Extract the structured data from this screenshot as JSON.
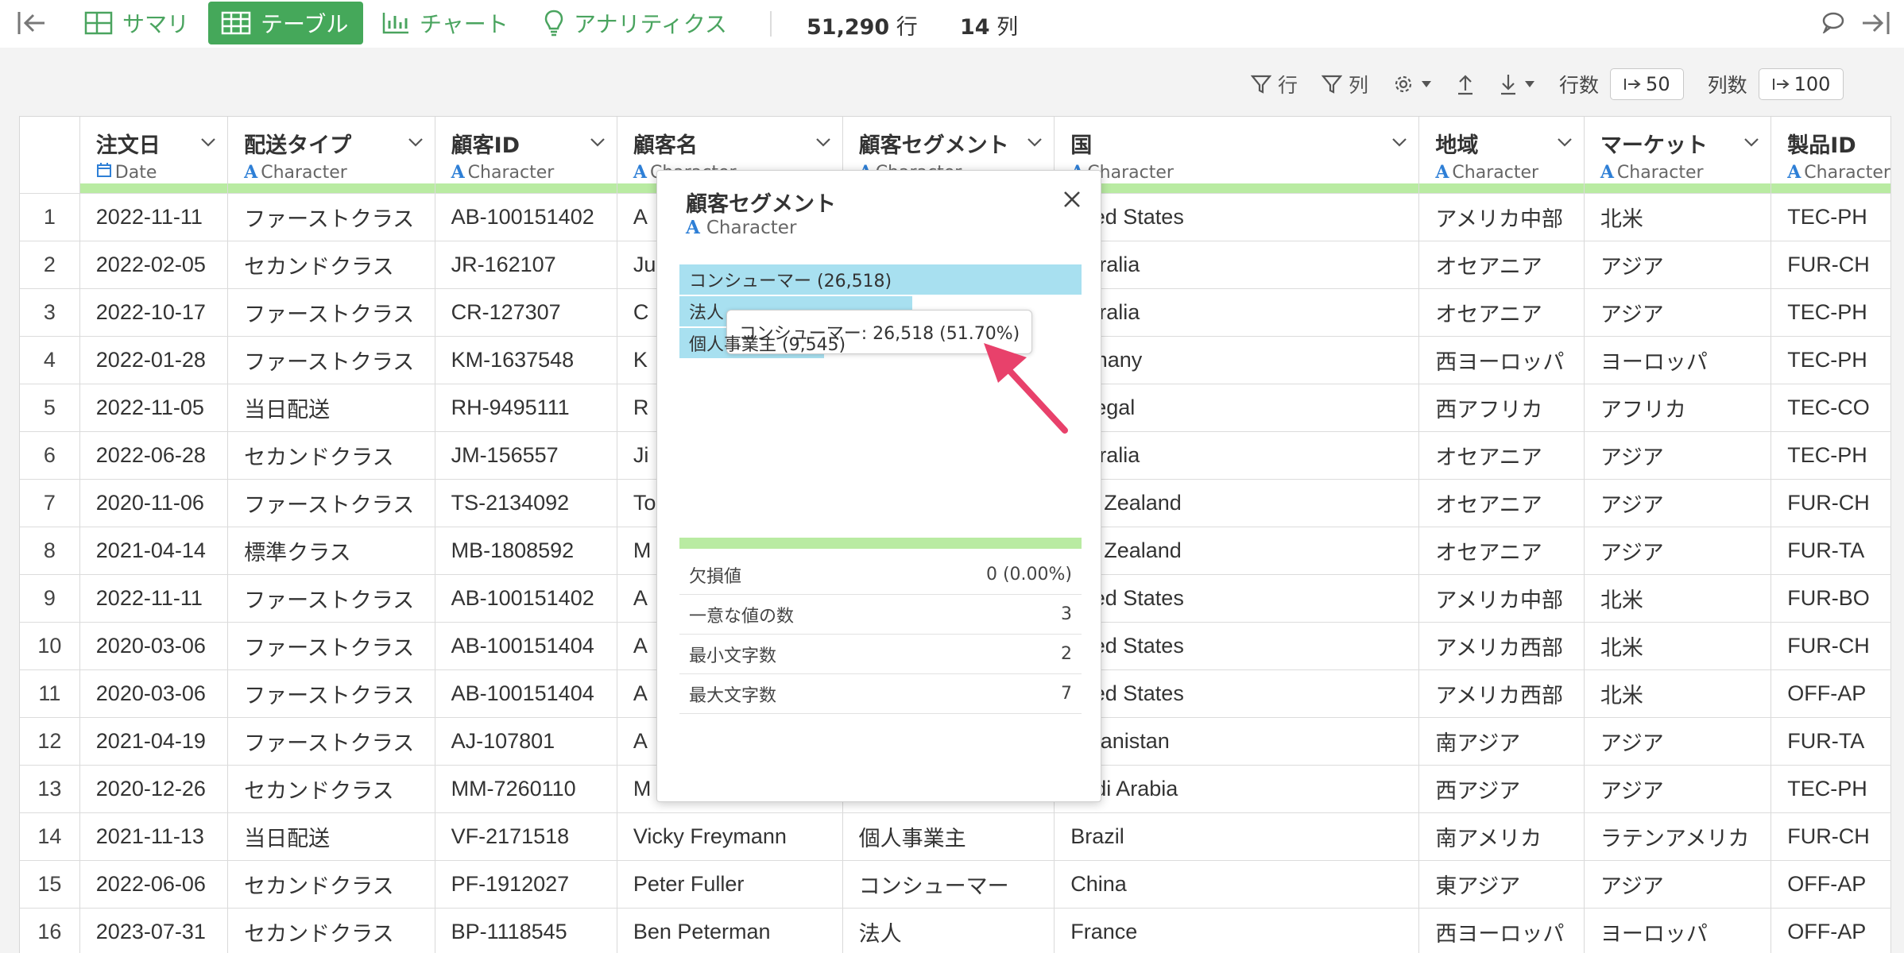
{
  "topbar": {
    "tabs": [
      {
        "label": "サマリ",
        "icon": "table-outline-icon"
      },
      {
        "label": "テーブル",
        "icon": "table-grid-icon",
        "active": true
      },
      {
        "label": "チャート",
        "icon": "bar-chart-icon"
      },
      {
        "label": "アナリティクス",
        "icon": "lightbulb-icon"
      }
    ],
    "rows_count": "51,290",
    "rows_unit": "行",
    "cols_count": "14",
    "cols_unit": "列"
  },
  "toolbar": {
    "row_filter": "行",
    "col_filter": "列",
    "rows_label": "行数",
    "rows_value": "50",
    "cols_label": "列数",
    "cols_value": "100"
  },
  "table": {
    "columns": [
      {
        "title": "注文日",
        "type": "Date"
      },
      {
        "title": "配送タイプ",
        "type": "Character"
      },
      {
        "title": "顧客ID",
        "type": "Character"
      },
      {
        "title": "顧客名",
        "type": "Character"
      },
      {
        "title": "顧客セグメント",
        "type": "Character"
      },
      {
        "title": "国",
        "type": "Character"
      },
      {
        "title": "地域",
        "type": "Character"
      },
      {
        "title": "マーケット",
        "type": "Character"
      },
      {
        "title": "製品ID",
        "type": "Character"
      }
    ],
    "rows": [
      [
        "1",
        "2022-11-11",
        "ファーストクラス",
        "AB-100151402",
        "A",
        "",
        "nited States",
        "アメリカ中部",
        "北米",
        "TEC-PH"
      ],
      [
        "2",
        "2022-02-05",
        "セカンドクラス",
        "JR-162107",
        "Ju",
        "",
        "ustralia",
        "オセアニア",
        "アジア",
        "FUR-CH"
      ],
      [
        "3",
        "2022-10-17",
        "ファーストクラス",
        "CR-127307",
        "C",
        "",
        "ustralia",
        "オセアニア",
        "アジア",
        "TEC-PH"
      ],
      [
        "4",
        "2022-01-28",
        "ファーストクラス",
        "KM-1637548",
        "K",
        "",
        "ermany",
        "西ヨーロッパ",
        "ヨーロッパ",
        "TEC-PH"
      ],
      [
        "5",
        "2022-11-05",
        "当日配送",
        "RH-9495111",
        "R",
        "",
        "enegal",
        "西アフリカ",
        "アフリカ",
        "TEC-CO"
      ],
      [
        "6",
        "2022-06-28",
        "セカンドクラス",
        "JM-156557",
        "Ji",
        "",
        "ustralia",
        "オセアニア",
        "アジア",
        "TEC-PH"
      ],
      [
        "7",
        "2020-11-06",
        "ファーストクラス",
        "TS-2134092",
        "To",
        "",
        "ew Zealand",
        "オセアニア",
        "アジア",
        "FUR-CH"
      ],
      [
        "8",
        "2021-04-14",
        "標準クラス",
        "MB-1808592",
        "M",
        "",
        "ew Zealand",
        "オセアニア",
        "アジア",
        "FUR-TA"
      ],
      [
        "9",
        "2022-11-11",
        "ファーストクラス",
        "AB-100151402",
        "A",
        "",
        "nited States",
        "アメリカ中部",
        "北米",
        "FUR-BO"
      ],
      [
        "10",
        "2020-03-06",
        "ファーストクラス",
        "AB-100151404",
        "A",
        "",
        "nited States",
        "アメリカ西部",
        "北米",
        "FUR-CH"
      ],
      [
        "11",
        "2020-03-06",
        "ファーストクラス",
        "AB-100151404",
        "A",
        "",
        "nited States",
        "アメリカ西部",
        "北米",
        "OFF-AP"
      ],
      [
        "12",
        "2021-04-19",
        "ファーストクラス",
        "AJ-107801",
        "A",
        "",
        "fghanistan",
        "南アジア",
        "アジア",
        "FUR-TA"
      ],
      [
        "13",
        "2020-12-26",
        "セカンドクラス",
        "MM-7260110",
        "M",
        "",
        "audi Arabia",
        "西アジア",
        "アジア",
        "TEC-PH"
      ],
      [
        "14",
        "2021-11-13",
        "当日配送",
        "VF-2171518",
        "Vicky Freymann",
        "個人事業主",
        "Brazil",
        "南アメリカ",
        "ラテンアメリカ",
        "FUR-CH"
      ],
      [
        "15",
        "2022-06-06",
        "セカンドクラス",
        "PF-1912027",
        "Peter Fuller",
        "コンシューマー",
        "China",
        "東アジア",
        "アジア",
        "OFF-AP"
      ],
      [
        "16",
        "2023-07-31",
        "セカンドクラス",
        "BP-1118545",
        "Ben Peterman",
        "法人",
        "France",
        "西ヨーロッパ",
        "ヨーロッパ",
        "OFF-AP"
      ]
    ]
  },
  "popup": {
    "title": "顧客セグメント",
    "type": "Character",
    "bars": [
      {
        "label": "コンシューマー (26,518)",
        "fraction": 1.0
      },
      {
        "label": "法人",
        "fraction": 0.58
      },
      {
        "label": "個人事業主 (9,545)",
        "fraction": 0.36
      }
    ],
    "stats": [
      {
        "label": "欠損値",
        "value": "0 (0.00%)"
      },
      {
        "label": "一意な値の数",
        "value": "3"
      },
      {
        "label": "最小文字数",
        "value": "2"
      },
      {
        "label": "最大文字数",
        "value": "7"
      }
    ],
    "tooltip": "コンシューマー: 26,518 (51.70%)"
  },
  "colors": {
    "accent_green": "#45a85a",
    "profile_bar": "#b9eba2",
    "category_bar": "#a8e0f0",
    "arrow": "#e8416b",
    "type_icon": "#2e7fd6"
  }
}
